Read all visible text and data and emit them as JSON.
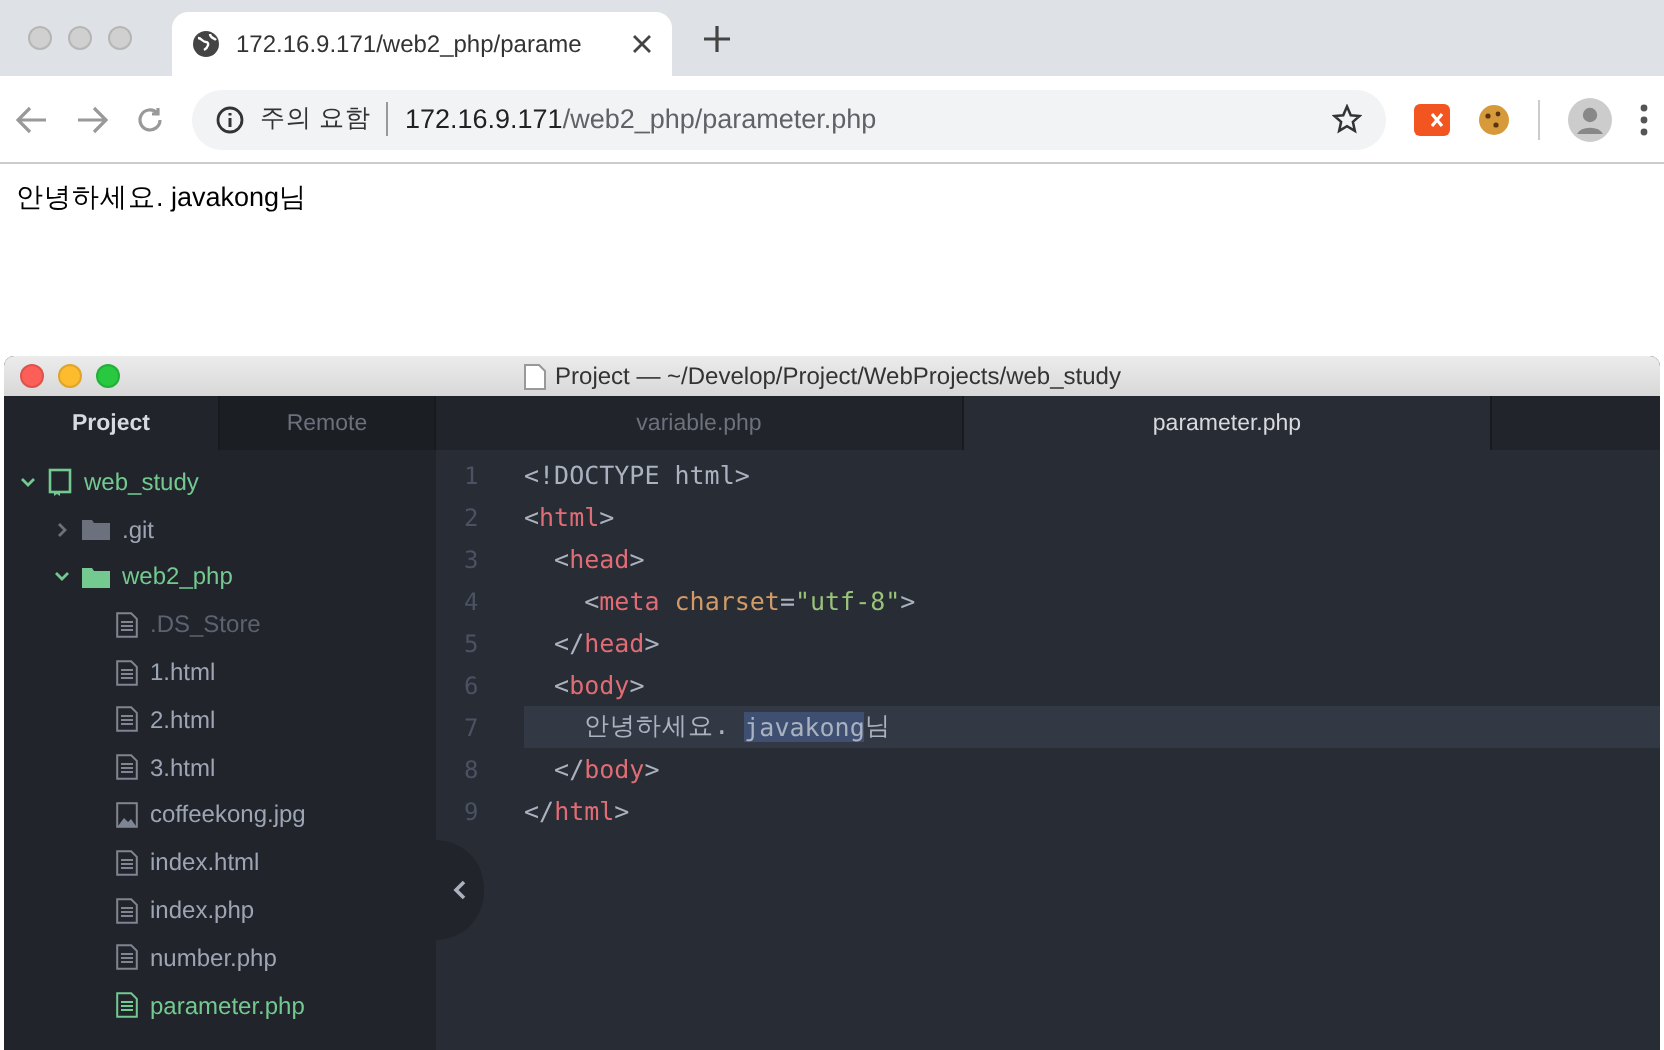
{
  "browser": {
    "tab": {
      "title": "172.16.9.171/web2_php/parame",
      "selected": true
    },
    "address": {
      "security": "주의 요함",
      "host": "172.16.9.171",
      "path": "/web2_php/parameter.php"
    }
  },
  "page": {
    "text": "안녕하세요. javakong님"
  },
  "editor": {
    "window_title": "Project — ~/Develop/Project/WebProjects/web_study",
    "panel_tabs": [
      {
        "label": "Project",
        "selected": true
      },
      {
        "label": "Remote",
        "selected": false
      }
    ],
    "tree": [
      {
        "name": "web_study",
        "kind": "project",
        "color": "#73c990",
        "expanded": true,
        "children": [
          {
            "name": ".git",
            "kind": "folder",
            "color": "#9da5b4",
            "expanded": false
          },
          {
            "name": "web2_php",
            "kind": "folder",
            "color": "#73c990",
            "expanded": true,
            "children": [
              {
                "name": ".DS_Store",
                "kind": "file",
                "color": "#5c6370"
              },
              {
                "name": "1.html",
                "kind": "file",
                "color": "#9da5b4"
              },
              {
                "name": "2.html",
                "kind": "file",
                "color": "#9da5b4"
              },
              {
                "name": "3.html",
                "kind": "file",
                "color": "#9da5b4"
              },
              {
                "name": "coffeekong.jpg",
                "kind": "image",
                "color": "#9da5b4"
              },
              {
                "name": "index.html",
                "kind": "file",
                "color": "#9da5b4"
              },
              {
                "name": "index.php",
                "kind": "file",
                "color": "#9da5b4"
              },
              {
                "name": "number.php",
                "kind": "file",
                "color": "#9da5b4"
              },
              {
                "name": "parameter.php",
                "kind": "file",
                "color": "#73c990"
              }
            ]
          }
        ]
      }
    ],
    "file_tabs": [
      {
        "label": "variable.php",
        "selected": false
      },
      {
        "label": "parameter.php",
        "selected": true
      }
    ],
    "lines": [
      {
        "number": "1",
        "cursor": false,
        "tokens": [
          {
            "kind": "punct",
            "text": "<!DOCTYPE html>"
          }
        ]
      },
      {
        "number": "2",
        "cursor": false,
        "tokens": [
          {
            "kind": "punct",
            "text": "<"
          },
          {
            "kind": "tag",
            "text": "html"
          },
          {
            "kind": "punct",
            "text": ">"
          }
        ]
      },
      {
        "number": "3",
        "cursor": false,
        "tokens": [
          {
            "kind": "punct",
            "text": "  <"
          },
          {
            "kind": "tag",
            "text": "head"
          },
          {
            "kind": "punct",
            "text": ">"
          }
        ]
      },
      {
        "number": "4",
        "cursor": false,
        "tokens": [
          {
            "kind": "punct",
            "text": "    <"
          },
          {
            "kind": "tag",
            "text": "meta"
          },
          {
            "kind": "attr",
            "text": "charset"
          },
          {
            "kind": "punct",
            "text": "="
          },
          {
            "kind": "string",
            "text": "\"utf-8\""
          },
          {
            "kind": "punct",
            "text": ">"
          }
        ]
      },
      {
        "number": "5",
        "cursor": false,
        "tokens": [
          {
            "kind": "punct",
            "text": "  </"
          },
          {
            "kind": "tag",
            "text": "head"
          },
          {
            "kind": "punct",
            "text": ">"
          }
        ]
      },
      {
        "number": "6",
        "cursor": false,
        "tokens": [
          {
            "kind": "punct",
            "text": "  <"
          },
          {
            "kind": "tag",
            "text": "body"
          },
          {
            "kind": "punct",
            "text": ">"
          }
        ]
      },
      {
        "number": "7",
        "cursor": true,
        "tokens": [
          {
            "kind": "punct",
            "text": "    안녕하세요. "
          },
          {
            "kind": "selection",
            "text": "javakong"
          },
          {
            "kind": "punct",
            "text": "님"
          }
        ]
      },
      {
        "number": "8",
        "cursor": false,
        "tokens": [
          {
            "kind": "punct",
            "text": "  </"
          },
          {
            "kind": "tag",
            "text": "body"
          },
          {
            "kind": "punct",
            "text": ">"
          }
        ]
      },
      {
        "number": "9",
        "cursor": false,
        "tokens": [
          {
            "kind": "punct",
            "text": "</"
          },
          {
            "kind": "tag",
            "text": "html"
          },
          {
            "kind": "punct",
            "text": ">"
          }
        ]
      }
    ]
  }
}
